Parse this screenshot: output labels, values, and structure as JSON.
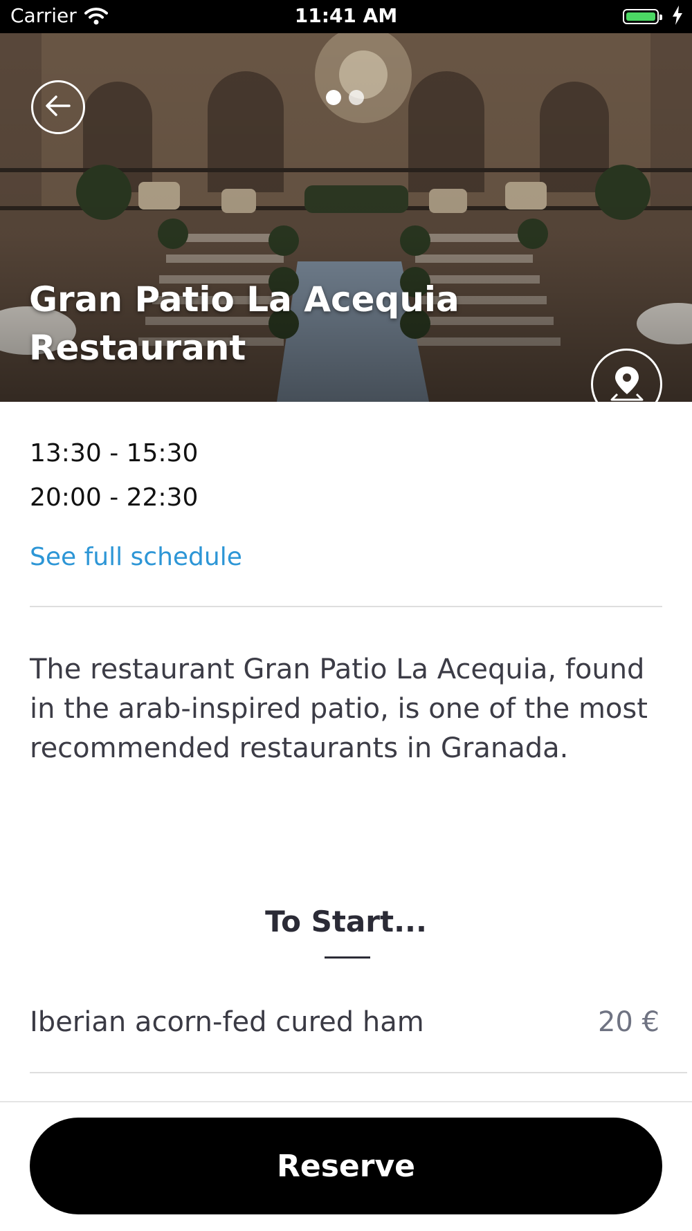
{
  "status_bar": {
    "carrier": "Carrier",
    "time": "11:41 AM"
  },
  "hero": {
    "title_line1": "Gran Patio La Acequia",
    "title_line2": "Restaurant",
    "carousel": {
      "count": 2,
      "active_index": 0
    },
    "back_icon": "arrow-left-circle-icon",
    "map_icon": "map-pin-icon"
  },
  "schedule": {
    "hours": [
      "13:30 - 15:30",
      "20:00 - 22:30"
    ],
    "link_label": "See full schedule"
  },
  "description": "The restaurant Gran Patio La Acequia, found in the arab-inspired patio, is one of the most recommended restaurants in Granada.",
  "menu": {
    "section_title": "To Start...",
    "items": [
      {
        "name": "Iberian acorn-fed cured ham",
        "price": "20 €"
      }
    ]
  },
  "actions": {
    "reserve_label": "Reserve"
  },
  "colors": {
    "link": "#2d96d6",
    "button": "#000000",
    "battery": "#4cd964"
  }
}
